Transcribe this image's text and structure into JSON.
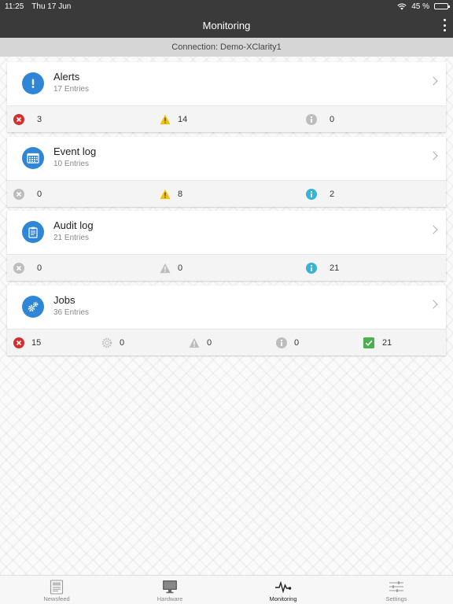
{
  "status_bar": {
    "time": "11:25",
    "date": "Thu 17 Jun",
    "battery": "45 %",
    "battery_level": 0.45
  },
  "header": {
    "title": "Monitoring",
    "connection": "Connection: Demo-XClarity1"
  },
  "cards": [
    {
      "title": "Alerts",
      "entries": "17 Entries",
      "icon": "alert-icon",
      "stats": [
        {
          "icon": "error-icon",
          "value": "3"
        },
        {
          "icon": "warning-icon",
          "value": "14"
        },
        {
          "icon": "info-icon",
          "value": "0"
        }
      ]
    },
    {
      "title": "Event log",
      "entries": "10 Entries",
      "icon": "calendar-icon",
      "stats": [
        {
          "icon": "error-icon",
          "value": "0"
        },
        {
          "icon": "warning-icon",
          "value": "8"
        },
        {
          "icon": "info-icon",
          "value": "2"
        }
      ]
    },
    {
      "title": "Audit log",
      "entries": "21 Entries",
      "icon": "clipboard-icon",
      "stats": [
        {
          "icon": "error-icon",
          "value": "0"
        },
        {
          "icon": "warning-icon",
          "value": "0"
        },
        {
          "icon": "info-icon",
          "value": "21"
        }
      ]
    },
    {
      "title": "Jobs",
      "entries": "36 Entries",
      "icon": "gears-icon",
      "stats": [
        {
          "icon": "error-icon",
          "value": "15"
        },
        {
          "icon": "running-icon",
          "value": "0"
        },
        {
          "icon": "warning-icon",
          "value": "0"
        },
        {
          "icon": "info-icon",
          "value": "0"
        },
        {
          "icon": "complete-icon",
          "value": "21"
        }
      ]
    }
  ],
  "tabs": [
    {
      "label": "Newsfeed",
      "icon": "newsfeed-icon"
    },
    {
      "label": "Hardware",
      "icon": "monitor-icon"
    },
    {
      "label": "Monitoring",
      "icon": "pulse-icon",
      "active": true
    },
    {
      "label": "Settings",
      "icon": "sliders-icon"
    }
  ],
  "colors": {
    "accent": "#2f86d6",
    "error": "#d32f2f",
    "warning": "#f2c200",
    "info": "#39b3d7",
    "success": "#4caf50",
    "inactive": "#bdbdbd",
    "header": "#3a3a3a"
  }
}
